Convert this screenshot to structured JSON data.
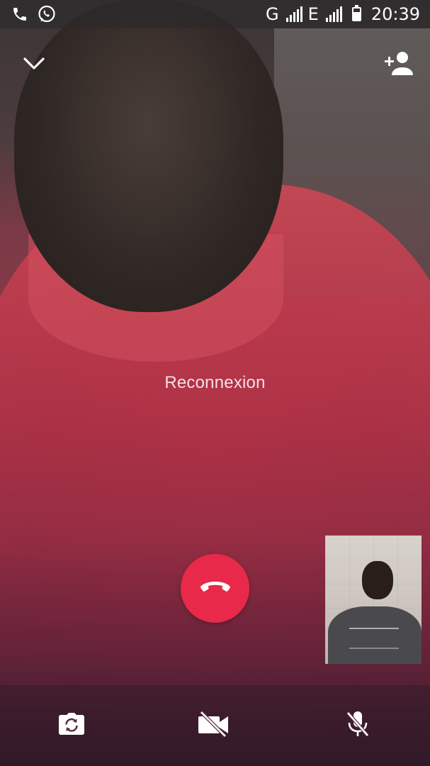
{
  "status_bar": {
    "network_1": "G",
    "network_2": "E",
    "time": "20:39",
    "left_icons": [
      "phone-icon",
      "whatsapp-icon"
    ],
    "right_icons": [
      "signal-icon",
      "signal-icon",
      "battery-icon"
    ]
  },
  "top_bar": {
    "collapse_icon": "chevron-down-icon",
    "add_participant_icon": "add-person-icon"
  },
  "call": {
    "status_text": "Reconnexion"
  },
  "controls": {
    "end_call_icon": "hang-up-icon",
    "end_call_color": "#e8294a",
    "switch_camera_icon": "switch-camera-icon",
    "video_off_icon": "video-off-icon",
    "mute_icon": "mic-off-icon"
  }
}
